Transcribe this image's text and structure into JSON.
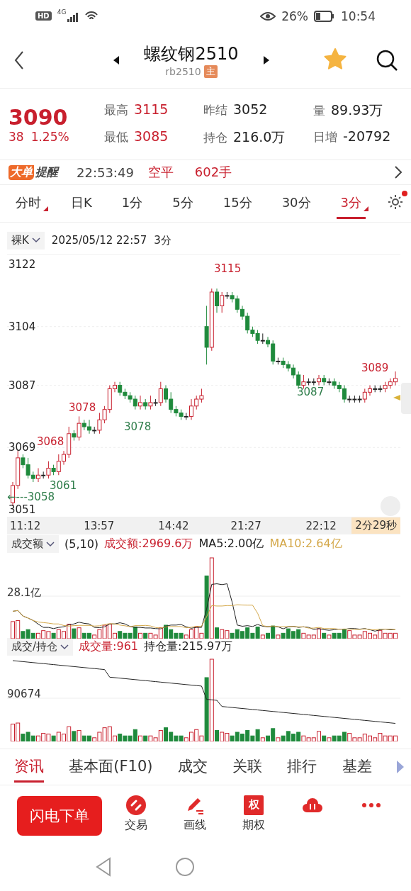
{
  "status_bar": {
    "indicator": "HD",
    "network": "4G",
    "battery": "26%",
    "time": "10:54"
  },
  "header": {
    "title": "螺纹钢2510",
    "code": "rb2510",
    "badge": "主",
    "favorite": true
  },
  "quote": {
    "price": "3090",
    "change": "38",
    "change_pct": "1.25%",
    "stats": [
      {
        "label": "最高",
        "value": "3115",
        "color": "#c8202e"
      },
      {
        "label": "昨结",
        "value": "3052",
        "color": "#222222"
      },
      {
        "label": "量",
        "value": "89.93万",
        "color": "#222222"
      },
      {
        "label": "最低",
        "value": "3085",
        "color": "#c8202e"
      },
      {
        "label": "持仓",
        "value": "216.0万",
        "color": "#222222"
      },
      {
        "label": "日增",
        "value": "-20792",
        "color": "#222222"
      }
    ]
  },
  "alert": {
    "badge_left": "大单",
    "badge_right": "提醒",
    "time": "22:53:49",
    "action": "空平",
    "volume": "602手"
  },
  "periods": [
    {
      "label": "分时",
      "selected": false,
      "menu": true
    },
    {
      "label": "日K",
      "selected": false,
      "menu": false
    },
    {
      "label": "1分",
      "selected": false,
      "menu": false
    },
    {
      "label": "5分",
      "selected": false,
      "menu": false
    },
    {
      "label": "15分",
      "selected": false,
      "menu": false
    },
    {
      "label": "30分",
      "selected": false,
      "menu": false
    },
    {
      "label": "3分",
      "selected": true,
      "menu": true
    }
  ],
  "settings": {
    "notification": true
  },
  "price_chart": {
    "style": "裸K",
    "datetime": "2025/05/12 22:57",
    "period": "3分",
    "chart_data": {
      "type": "candlestick",
      "grid": true,
      "ohlc": [
        [
          3053,
          3059,
          3052,
          3058
        ],
        [
          3058,
          3068,
          3057,
          3066
        ],
        [
          3066,
          3067,
          3063,
          3064
        ],
        [
          3064,
          3066,
          3060,
          3061
        ],
        [
          3061,
          3062,
          3059,
          3060
        ],
        [
          3060,
          3063,
          3059,
          3061
        ],
        [
          3061,
          3062,
          3060,
          3061
        ],
        [
          3061,
          3065,
          3060,
          3063
        ],
        [
          3063,
          3064,
          3061,
          3062
        ],
        [
          3062,
          3067,
          3061,
          3065
        ],
        [
          3065,
          3068,
          3064,
          3067
        ],
        [
          3067,
          3075,
          3066,
          3073
        ],
        [
          3073,
          3074,
          3071,
          3072
        ],
        [
          3072,
          3078,
          3071,
          3076
        ],
        [
          3076,
          3077,
          3074,
          3075
        ],
        [
          3075,
          3077,
          3073,
          3074
        ],
        [
          3074,
          3075,
          3073,
          3074
        ],
        [
          3074,
          3079,
          3073,
          3077
        ],
        [
          3077,
          3081,
          3076,
          3080
        ],
        [
          3080,
          3087,
          3079,
          3086
        ],
        [
          3086,
          3088,
          3085,
          3087
        ],
        [
          3087,
          3088,
          3084,
          3085
        ],
        [
          3085,
          3086,
          3083,
          3084
        ],
        [
          3084,
          3085,
          3082,
          3083
        ],
        [
          3083,
          3084,
          3080,
          3081
        ],
        [
          3081,
          3084,
          3080,
          3082
        ],
        [
          3082,
          3083,
          3080,
          3081
        ],
        [
          3081,
          3084,
          3080,
          3082
        ],
        [
          3082,
          3083,
          3081,
          3082
        ],
        [
          3082,
          3088,
          3081,
          3086
        ],
        [
          3086,
          3087,
          3082,
          3083
        ],
        [
          3083,
          3085,
          3079,
          3080
        ],
        [
          3080,
          3081,
          3078,
          3079
        ],
        [
          3079,
          3080,
          3077,
          3078
        ],
        [
          3078,
          3079,
          3077,
          3078
        ],
        [
          3078,
          3083,
          3077,
          3081
        ],
        [
          3081,
          3084,
          3080,
          3083
        ],
        [
          3083,
          3086,
          3082,
          3084
        ],
        [
          3104,
          3110,
          3093,
          3098
        ],
        [
          3098,
          3115,
          3097,
          3114
        ],
        [
          3114,
          3115,
          3108,
          3110
        ],
        [
          3110,
          3114,
          3108,
          3113
        ],
        [
          3113,
          3114,
          3112,
          3113
        ],
        [
          3113,
          3114,
          3111,
          3112
        ],
        [
          3112,
          3113,
          3108,
          3109
        ],
        [
          3109,
          3110,
          3106,
          3107
        ],
        [
          3107,
          3108,
          3102,
          3103
        ],
        [
          3103,
          3104,
          3101,
          3102
        ],
        [
          3102,
          3103,
          3099,
          3100
        ],
        [
          3100,
          3102,
          3099,
          3100
        ],
        [
          3100,
          3101,
          3098,
          3099
        ],
        [
          3099,
          3100,
          3093,
          3094
        ],
        [
          3094,
          3095,
          3093,
          3094
        ],
        [
          3094,
          3095,
          3092,
          3093
        ],
        [
          3093,
          3094,
          3091,
          3092
        ],
        [
          3092,
          3093,
          3089,
          3090
        ],
        [
          3090,
          3091,
          3086,
          3087
        ],
        [
          3087,
          3090,
          3086,
          3088
        ],
        [
          3088,
          3089,
          3087,
          3088
        ],
        [
          3088,
          3089,
          3087,
          3088
        ],
        [
          3088,
          3090,
          3087,
          3089
        ],
        [
          3089,
          3090,
          3087,
          3088
        ],
        [
          3088,
          3089,
          3087,
          3088
        ],
        [
          3088,
          3089,
          3086,
          3087
        ],
        [
          3087,
          3088,
          3085,
          3086
        ],
        [
          3086,
          3087,
          3082,
          3083
        ],
        [
          3083,
          3084,
          3082,
          3083
        ],
        [
          3083,
          3084,
          3082,
          3083
        ],
        [
          3083,
          3084,
          3082,
          3083
        ],
        [
          3083,
          3086,
          3082,
          3085
        ],
        [
          3085,
          3087,
          3084,
          3086
        ],
        [
          3086,
          3087,
          3085,
          3086
        ],
        [
          3086,
          3087,
          3085,
          3086
        ],
        [
          3086,
          3088,
          3085,
          3087
        ],
        [
          3087,
          3089,
          3086,
          3088
        ],
        [
          3088,
          3091,
          3087,
          3089
        ]
      ],
      "ylim": [
        3051,
        3122
      ],
      "yticks": [
        {
          "value": 3122,
          "label": "3122"
        },
        {
          "value": 3104,
          "label": "3104"
        },
        {
          "value": 3087,
          "label": "3087"
        },
        {
          "value": 3069,
          "label": "3069"
        },
        {
          "value": 3051,
          "label": "3051"
        }
      ]
    },
    "x_labels": [
      "11:12",
      "13:57",
      "14:42",
      "21:27",
      "22:12"
    ],
    "annotations": [
      {
        "text": "3115",
        "color": "#c8202e"
      },
      {
        "text": "3078",
        "color": "#c8202e"
      },
      {
        "text": "3068",
        "color": "#c8202e"
      },
      {
        "text": "3078",
        "color": "#2e7d4a"
      },
      {
        "text": "3061",
        "color": "#2e7d4a"
      },
      {
        "text": "←---3058",
        "color": "#2e7d4a"
      },
      {
        "text": "3087",
        "color": "#2e7d4a"
      },
      {
        "text": "3089",
        "color": "#c8202e"
      }
    ],
    "countdown": "2分29秒"
  },
  "turnover_panel": {
    "selector": "成交额",
    "params": "(5,10)",
    "items": [
      {
        "text": "成交额:2969.6万",
        "color": "#c8202e"
      },
      {
        "text": "MA5:2.00亿",
        "color": "#222222"
      },
      {
        "text": "MA10:2.64亿",
        "color": "#d4a84a"
      }
    ],
    "axis_label": "28.1亿"
  },
  "volume_panel": {
    "selector": "成交/持仓",
    "items": [
      {
        "text": "成交量:961",
        "color": "#c8202e"
      },
      {
        "text": "持仓量:215.97万",
        "color": "#222222"
      }
    ],
    "axis_label": "90674"
  },
  "bottom_tabs": [
    {
      "label": "资讯",
      "selected": true
    },
    {
      "label": "基本面(F10)",
      "selected": false
    },
    {
      "label": "成交",
      "selected": false
    },
    {
      "label": "关联",
      "selected": false
    },
    {
      "label": "排行",
      "selected": false
    },
    {
      "label": "基差",
      "selected": false
    }
  ],
  "toolbar": {
    "primary": "闪电下单",
    "items": [
      {
        "kind": "trade",
        "label": "交易"
      },
      {
        "kind": "draw",
        "label": "画线"
      },
      {
        "kind": "option",
        "label": "期权",
        "glyph": "权"
      },
      {
        "kind": "cloud"
      },
      {
        "kind": "more"
      }
    ]
  }
}
